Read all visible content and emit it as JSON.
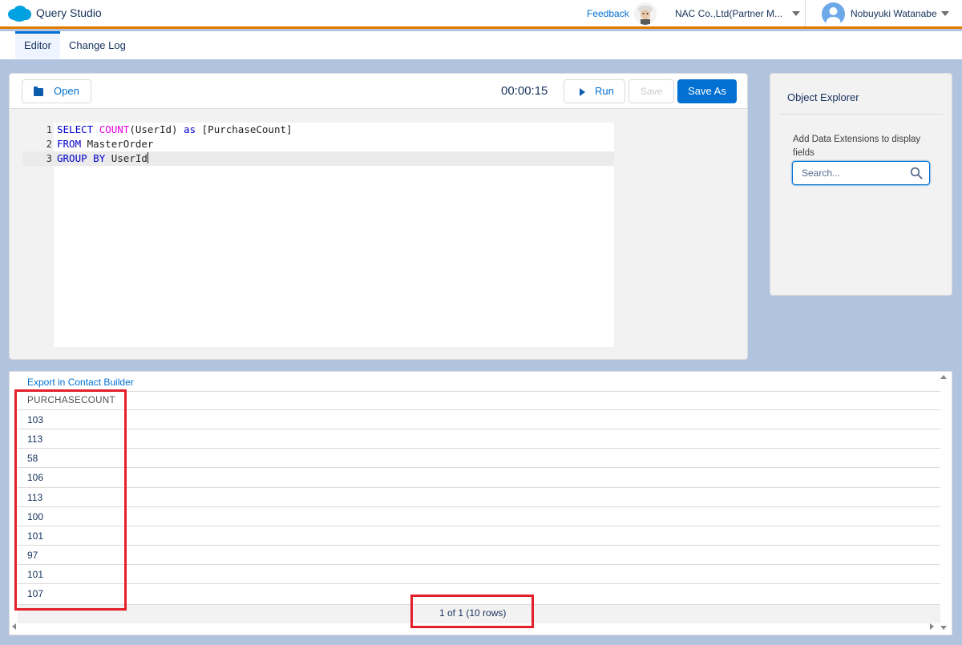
{
  "header": {
    "app_title": "Query Studio",
    "feedback_label": "Feedback",
    "org_name": "NAC Co.,Ltd(Partner M...",
    "user_name": "Nobuyuki Watanabe"
  },
  "tabs": [
    {
      "label": "Editor",
      "active": true
    },
    {
      "label": "Change Log",
      "active": false
    }
  ],
  "toolbar": {
    "open_label": "Open",
    "timer": "00:00:15",
    "run_label": "Run",
    "save_label": "Save",
    "save_as_label": "Save As"
  },
  "editor": {
    "line_numbers": [
      "1",
      "2",
      "3"
    ],
    "lines": [
      "SELECT COUNT(UserId) as [PurchaseCount]",
      "FROM MasterOrder",
      "GROUP BY UserId"
    ]
  },
  "explorer": {
    "title": "Object Explorer",
    "hint": "Add Data Extensions to display fields",
    "search_placeholder": "Search..."
  },
  "results": {
    "export_label": "Export in Contact Builder",
    "column_header": "PURCHASECOUNT",
    "rows": [
      "103",
      "113",
      "58",
      "106",
      "113",
      "100",
      "101",
      "97",
      "101",
      "107"
    ],
    "pager_text": "1 of 1 (10 rows)"
  },
  "colors": {
    "brand_blue": "#0070d2",
    "accent_orange": "#e07b00",
    "annotation_red": "#e3202a"
  }
}
